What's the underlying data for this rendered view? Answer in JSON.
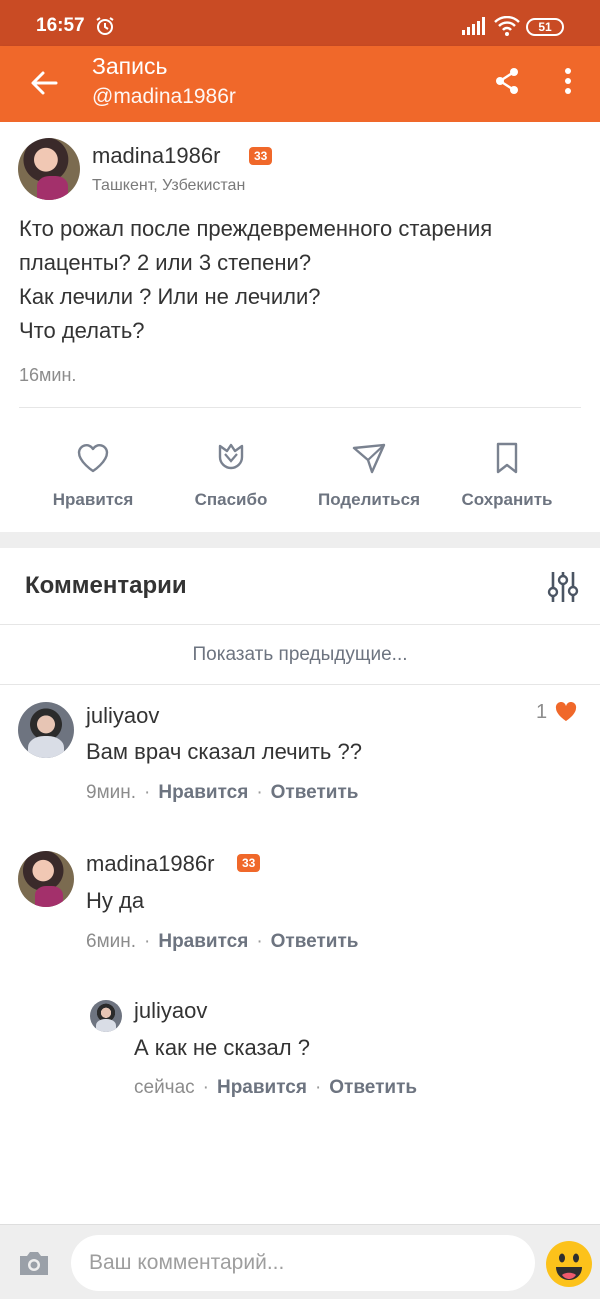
{
  "status_bar": {
    "time": "16:57",
    "battery": "51"
  },
  "app_bar": {
    "title": "Запись",
    "subtitle": "@madina1986r"
  },
  "post": {
    "author": "madina1986r",
    "badge": "33",
    "location": "Ташкент, Узбекистан",
    "text": "Кто рожал после преждевременного старения плаценты? 2 или 3 степени?\nКак лечили ? Или не лечили?\nЧто делать?",
    "time": "16мин.",
    "actions": {
      "like": "Нравится",
      "thanks": "Спасибо",
      "share": "Поделиться",
      "save": "Сохранить"
    }
  },
  "comments": {
    "header": "Комментарии",
    "show_previous": "Показать предыдущие...",
    "items": [
      {
        "author": "juliyaov",
        "text": "Вам врач сказал лечить ??",
        "time": "9мин.",
        "like": "Нравится",
        "reply": "Ответить",
        "likes": "1"
      },
      {
        "author": "madina1986r",
        "badge": "33",
        "text": "Ну да",
        "time": "6мин.",
        "like": "Нравится",
        "reply": "Ответить"
      },
      {
        "author": "juliyaov",
        "text": "А как не сказал ?",
        "time": "сейчас",
        "like": "Нравится",
        "reply": "Ответить"
      }
    ]
  },
  "composer": {
    "placeholder": "Ваш комментарий..."
  },
  "colors": {
    "accent": "#f0682a",
    "status_bar": "#c94b24",
    "heart": "#f0682a"
  },
  "icons": [
    "alarm-icon",
    "signal-icon",
    "wifi-icon",
    "battery-icon",
    "back-arrow-icon",
    "share-icon",
    "more-vert-icon",
    "heart-outline-icon",
    "tulip-icon",
    "paper-plane-icon",
    "bookmark-icon",
    "filter-sliders-icon",
    "heart-filled-icon",
    "camera-icon",
    "emoji-icon"
  ]
}
